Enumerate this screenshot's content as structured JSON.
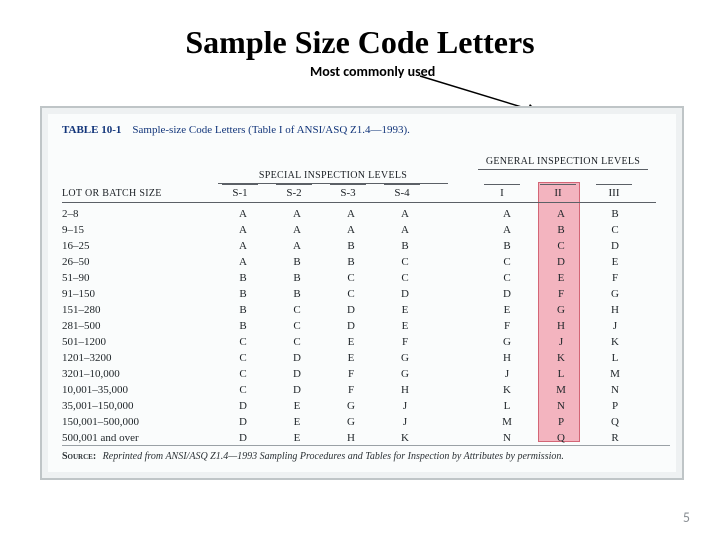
{
  "title": "Sample Size Code Letters",
  "callout": "Most commonly\nused",
  "page_number": "5",
  "table_caption": {
    "label": "TABLE 10-1",
    "text": "Sample-size Code Letters (Table I of ANSI/ASQ Z1.4—1993)."
  },
  "headers": {
    "lot": "LOT OR BATCH SIZE",
    "special": "SPECIAL INSPECTION LEVELS",
    "general": "GENERAL INSPECTION LEVELS",
    "cols": {
      "s1": "S-1",
      "s2": "S-2",
      "s3": "S-3",
      "s4": "S-4",
      "g1": "I",
      "g2": "II",
      "g3": "III"
    }
  },
  "rows": [
    {
      "range": "2–8",
      "s1": "A",
      "s2": "A",
      "s3": "A",
      "s4": "A",
      "g1": "A",
      "g2": "A",
      "g3": "B"
    },
    {
      "range": "9–15",
      "s1": "A",
      "s2": "A",
      "s3": "A",
      "s4": "A",
      "g1": "A",
      "g2": "B",
      "g3": "C"
    },
    {
      "range": "16–25",
      "s1": "A",
      "s2": "A",
      "s3": "B",
      "s4": "B",
      "g1": "B",
      "g2": "C",
      "g3": "D"
    },
    {
      "range": "26–50",
      "s1": "A",
      "s2": "B",
      "s3": "B",
      "s4": "C",
      "g1": "C",
      "g2": "D",
      "g3": "E"
    },
    {
      "range": "51–90",
      "s1": "B",
      "s2": "B",
      "s3": "C",
      "s4": "C",
      "g1": "C",
      "g2": "E",
      "g3": "F"
    },
    {
      "range": "91–150",
      "s1": "B",
      "s2": "B",
      "s3": "C",
      "s4": "D",
      "g1": "D",
      "g2": "F",
      "g3": "G"
    },
    {
      "range": "151–280",
      "s1": "B",
      "s2": "C",
      "s3": "D",
      "s4": "E",
      "g1": "E",
      "g2": "G",
      "g3": "H"
    },
    {
      "range": "281–500",
      "s1": "B",
      "s2": "C",
      "s3": "D",
      "s4": "E",
      "g1": "F",
      "g2": "H",
      "g3": "J"
    },
    {
      "range": "501–1200",
      "s1": "C",
      "s2": "C",
      "s3": "E",
      "s4": "F",
      "g1": "G",
      "g2": "J",
      "g3": "K"
    },
    {
      "range": "1201–3200",
      "s1": "C",
      "s2": "D",
      "s3": "E",
      "s4": "G",
      "g1": "H",
      "g2": "K",
      "g3": "L"
    },
    {
      "range": "3201–10,000",
      "s1": "C",
      "s2": "D",
      "s3": "F",
      "s4": "G",
      "g1": "J",
      "g2": "L",
      "g3": "M"
    },
    {
      "range": "10,001–35,000",
      "s1": "C",
      "s2": "D",
      "s3": "F",
      "s4": "H",
      "g1": "K",
      "g2": "M",
      "g3": "N"
    },
    {
      "range": "35,001–150,000",
      "s1": "D",
      "s2": "E",
      "s3": "G",
      "s4": "J",
      "g1": "L",
      "g2": "N",
      "g3": "P"
    },
    {
      "range": "150,001–500,000",
      "s1": "D",
      "s2": "E",
      "s3": "G",
      "s4": "J",
      "g1": "M",
      "g2": "P",
      "g3": "Q"
    },
    {
      "range": "500,001 and over",
      "s1": "D",
      "s2": "E",
      "s3": "H",
      "s4": "K",
      "g1": "N",
      "g2": "Q",
      "g3": "R"
    }
  ],
  "source": {
    "label": "Source:",
    "text": "Reprinted from ANSI/ASQ Z1.4—1993 Sampling Procedures and Tables for Inspection by Attributes by permission."
  },
  "chart_data": {
    "type": "table",
    "title": "Sample-size Code Letters (Table I of ANSI/ASQ Z1.4—1993)",
    "columns": [
      "Lot or batch size",
      "S-1",
      "S-2",
      "S-3",
      "S-4",
      "I",
      "II",
      "III"
    ],
    "highlighted_column": "II",
    "rows": [
      [
        "2–8",
        "A",
        "A",
        "A",
        "A",
        "A",
        "A",
        "B"
      ],
      [
        "9–15",
        "A",
        "A",
        "A",
        "A",
        "A",
        "B",
        "C"
      ],
      [
        "16–25",
        "A",
        "A",
        "B",
        "B",
        "B",
        "C",
        "D"
      ],
      [
        "26–50",
        "A",
        "B",
        "B",
        "C",
        "C",
        "D",
        "E"
      ],
      [
        "51–90",
        "B",
        "B",
        "C",
        "C",
        "C",
        "E",
        "F"
      ],
      [
        "91–150",
        "B",
        "B",
        "C",
        "D",
        "D",
        "F",
        "G"
      ],
      [
        "151–280",
        "B",
        "C",
        "D",
        "E",
        "E",
        "G",
        "H"
      ],
      [
        "281–500",
        "B",
        "C",
        "D",
        "E",
        "F",
        "H",
        "J"
      ],
      [
        "501–1200",
        "C",
        "C",
        "E",
        "F",
        "G",
        "J",
        "K"
      ],
      [
        "1201–3200",
        "C",
        "D",
        "E",
        "G",
        "H",
        "K",
        "L"
      ],
      [
        "3201–10,000",
        "C",
        "D",
        "F",
        "G",
        "J",
        "L",
        "M"
      ],
      [
        "10,001–35,000",
        "C",
        "D",
        "F",
        "H",
        "K",
        "M",
        "N"
      ],
      [
        "35,001–150,000",
        "D",
        "E",
        "G",
        "J",
        "L",
        "N",
        "P"
      ],
      [
        "150,001–500,000",
        "D",
        "E",
        "G",
        "J",
        "M",
        "P",
        "Q"
      ],
      [
        "500,001 and over",
        "D",
        "E",
        "H",
        "K",
        "N",
        "Q",
        "R"
      ]
    ]
  }
}
